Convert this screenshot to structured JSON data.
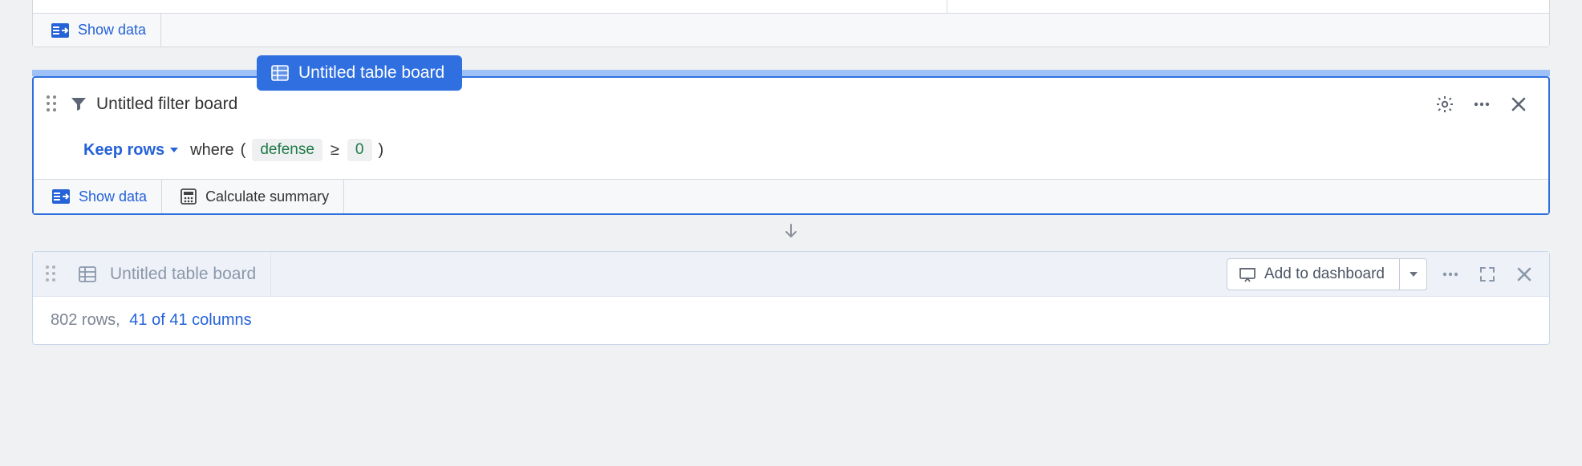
{
  "top_bar": {
    "show_data_label": "Show data"
  },
  "table_tab": {
    "title": "Untitled table board"
  },
  "filter_board": {
    "title": "Untitled filter board",
    "keep_rows_label": "Keep rows",
    "where_label": "where",
    "open_paren": "(",
    "close_paren": ")",
    "column_token": "defense",
    "operator": "≥",
    "value_token": "0",
    "show_data_label": "Show data",
    "calc_summary_label": "Calculate summary"
  },
  "result_board": {
    "title": "Untitled table board",
    "add_dashboard_label": "Add to dashboard",
    "rows_label": "802 rows,",
    "columns_label": "41 of 41 columns"
  }
}
